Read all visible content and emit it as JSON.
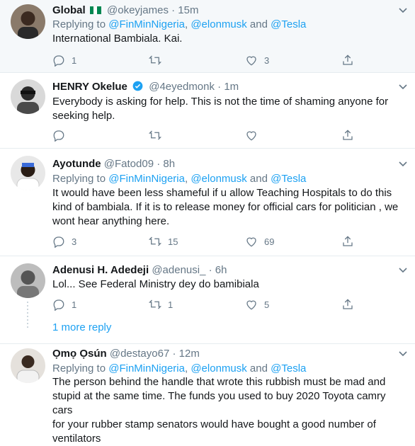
{
  "tweets": [
    {
      "name": "Global",
      "handle": "@okeyjames",
      "time": "15m",
      "replying_prefix": "Replying to ",
      "mentions": [
        "@FinMinNigeria",
        "@elonmusk",
        "@Tesla"
      ],
      "sep1": ", ",
      "sep2": " and ",
      "text": "International Bambiala. Kai.",
      "reply_count": "1",
      "retweet_count": "",
      "like_count": "3"
    },
    {
      "name": "HENRY Okelue",
      "handle": "@4eyedmonk",
      "time": "1m",
      "text_lines": [
        "Everybody is asking for help. This is not the time of shaming anyone for",
        "seeking help."
      ],
      "reply_count": "",
      "retweet_count": "",
      "like_count": ""
    },
    {
      "name": "Ayotunde",
      "handle": "@Fatod09",
      "time": "8h",
      "replying_prefix": "Replying to ",
      "mentions": [
        "@FinMinNigeria",
        "@elonmusk",
        "@Tesla"
      ],
      "sep1": ", ",
      "sep2": " and ",
      "text_lines": [
        "It would have been less shameful if u allow Teaching  Hospitals to do this",
        "kind of bambiala. If it is to release money for official cars for politician , we",
        "wont hear anything here."
      ],
      "reply_count": "3",
      "retweet_count": "15",
      "like_count": "69"
    },
    {
      "name": "Adenusi H. Adedeji",
      "handle": "@adenusi_",
      "time": "6h",
      "text": "Lol... See Federal Ministry dey do bamibiala",
      "reply_count": "1",
      "retweet_count": "1",
      "like_count": "5"
    },
    {
      "name": "Ọmọ Ọsún",
      "handle": "@destayo67",
      "time": "12m",
      "replying_prefix": "Replying to ",
      "mentions": [
        "@FinMinNigeria",
        "@elonmusk",
        "@Tesla"
      ],
      "sep1": ", ",
      "sep2": " and ",
      "text_lines": [
        "The person behind the handle that wrote this rubbish must be mad and",
        "stupid at the same time. The funds you used to buy 2020 Toyota camry cars",
        "for your rubber stamp senators would have bought a good number of",
        "ventilators"
      ]
    }
  ],
  "more_replies_label": "1 more reply",
  "colors": {
    "accent": "#1da1f2",
    "muted": "#657786",
    "border": "#e6ecf0",
    "highlight_bg": "#f5f8fa"
  }
}
